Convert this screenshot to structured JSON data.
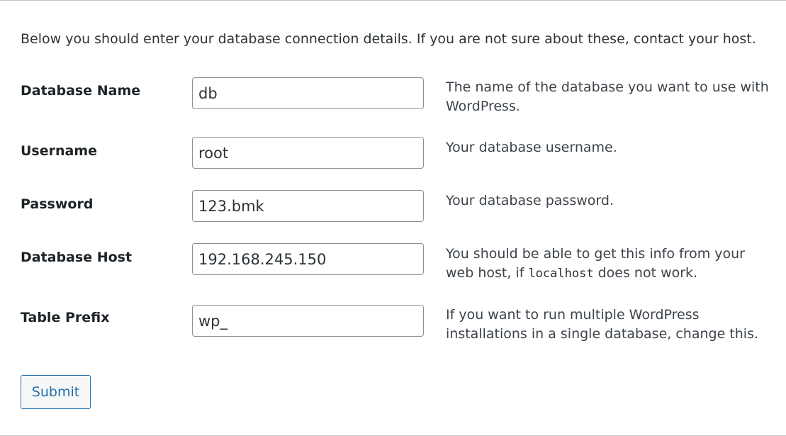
{
  "intro": "Below you should enter your database connection details. If you are not sure about these, contact your host.",
  "fields": {
    "dbname": {
      "label": "Database Name",
      "value": "db",
      "description": "The name of the database you want to use with WordPress."
    },
    "username": {
      "label": "Username",
      "value": "root",
      "description": "Your database username."
    },
    "password": {
      "label": "Password",
      "value": "123.bmk",
      "description": "Your database password."
    },
    "dbhost": {
      "label": "Database Host",
      "value": "192.168.245.150",
      "description_before": "You should be able to get this info from your web host, if ",
      "description_code": "localhost",
      "description_after": " does not work."
    },
    "prefix": {
      "label": "Table Prefix",
      "value": "wp_",
      "description": "If you want to run multiple WordPress installations in a single database, change this."
    }
  },
  "submit_label": "Submit",
  "colors": {
    "button_text": "#2271b1",
    "button_border": "#2271b1",
    "input_border": "#8c8f94"
  }
}
